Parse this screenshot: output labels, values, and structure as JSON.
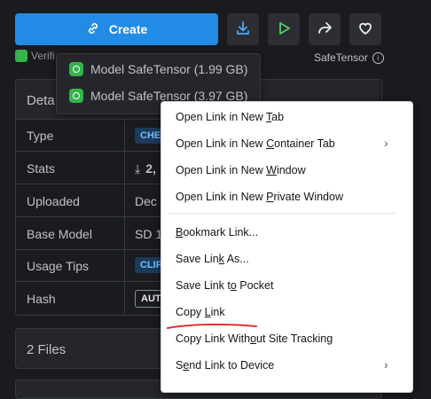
{
  "toolbar": {
    "create_label": "Create",
    "verified_label": "Verifi",
    "safetensor_label": "SafeTensor"
  },
  "details": {
    "title": "Deta",
    "rows": [
      {
        "label": "Type",
        "value": "CHEC"
      },
      {
        "label": "Stats",
        "value": "2,"
      },
      {
        "label": "Uploaded",
        "value": "Dec 2"
      },
      {
        "label": "Base Model",
        "value": "SD 1"
      },
      {
        "label": "Usage Tips",
        "value": "CLIP"
      },
      {
        "label": "Hash",
        "value": "AUT"
      }
    ]
  },
  "files": {
    "label": "2 Files"
  },
  "download_menu": {
    "items": [
      {
        "label": "Model SafeTensor (1.99 GB)"
      },
      {
        "label": "Model SafeTensor (3.97 GB)"
      }
    ]
  },
  "context_menu": {
    "items": [
      {
        "pre": "Open Link in New ",
        "key": "T",
        "post": "ab"
      },
      {
        "pre": "Open Link in New ",
        "key": "C",
        "post": "ontainer Tab"
      },
      {
        "pre": "Open Link in New ",
        "key": "W",
        "post": "indow"
      },
      {
        "pre": "Open Link in New ",
        "key": "P",
        "post": "rivate Window"
      },
      {
        "pre": "",
        "key": "B",
        "post": "ookmark Link..."
      },
      {
        "pre": "Save Lin",
        "key": "k",
        "post": " As..."
      },
      {
        "pre": "Save Link t",
        "key": "o",
        "post": " Pocket"
      },
      {
        "pre": "Copy ",
        "key": "L",
        "post": "ink"
      },
      {
        "pre": "Copy Link With",
        "key": "o",
        "post": "ut Site Tracking"
      },
      {
        "pre": "S",
        "key": "e",
        "post": "nd Link to Device"
      }
    ]
  },
  "colors": {
    "accent": "#228be6",
    "success": "#37b24d",
    "annotation": "#e03131"
  }
}
